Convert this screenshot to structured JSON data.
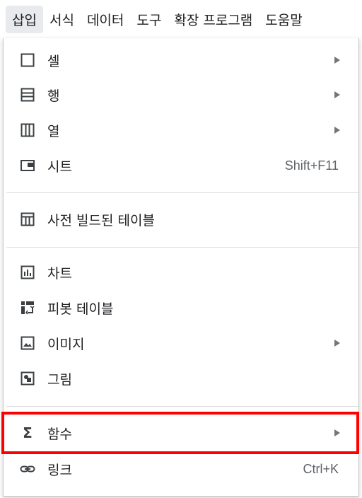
{
  "menubar": {
    "items": [
      {
        "label": "삽입"
      },
      {
        "label": "서식"
      },
      {
        "label": "데이터"
      },
      {
        "label": "도구"
      },
      {
        "label": "확장 프로그램"
      },
      {
        "label": "도움말"
      }
    ]
  },
  "menu": {
    "cell": {
      "label": "셀",
      "icon": "cell-icon"
    },
    "row": {
      "label": "행",
      "icon": "row-icon"
    },
    "column": {
      "label": "열",
      "icon": "column-icon"
    },
    "sheet": {
      "label": "시트",
      "shortcut": "Shift+F11",
      "icon": "sheet-icon"
    },
    "prebuilt_table": {
      "label": "사전 빌드된 테이블",
      "icon": "table-icon"
    },
    "chart": {
      "label": "차트",
      "icon": "chart-icon"
    },
    "pivot_table": {
      "label": "피봇 테이블",
      "icon": "pivot-table-icon"
    },
    "image": {
      "label": "이미지",
      "icon": "image-icon"
    },
    "drawing": {
      "label": "그림",
      "icon": "drawing-icon"
    },
    "function": {
      "label": "함수",
      "icon": "sigma-icon"
    },
    "link": {
      "label": "링크",
      "shortcut": "Ctrl+K",
      "icon": "link-icon"
    }
  },
  "colors": {
    "highlight": "#ff0000",
    "active_menu_bg": "#e8eaed",
    "text": "#202124"
  }
}
